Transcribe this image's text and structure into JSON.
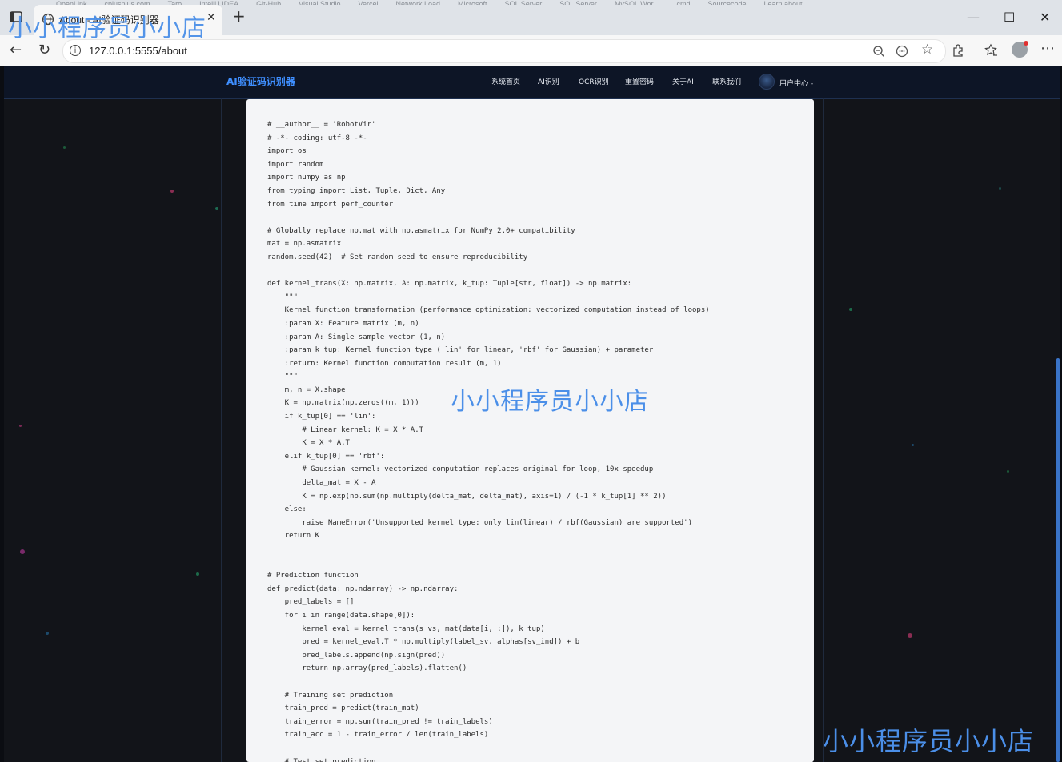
{
  "browser": {
    "bookmarks_partial": [
      "OpenLink",
      "cplusplus.com",
      "Taro",
      "IntelliJ IDEA",
      "Git-Hub",
      "Visual Studio",
      "Vercel",
      "Network Load",
      "Microsoft",
      "SQL Server",
      "SQL Server",
      "MySQL Wor...",
      "cmd",
      "Sourcecode",
      "Learn about"
    ],
    "tab_title": "About - AI验证码识别器",
    "url": "127.0.0.1:5555/about",
    "new_tab_symbol": "+",
    "close_symbol": "✕",
    "icons": [
      "window-icon",
      "globe-icon",
      "back-icon",
      "refresh-icon",
      "info-icon",
      "zoom-icon",
      "reader-icon",
      "favorite-icon",
      "extensions-icon",
      "collections-icon",
      "profile-icon",
      "more-icon",
      "minimize-icon",
      "maximize-icon",
      "close-icon"
    ]
  },
  "site": {
    "brand": "AI验证码识别器",
    "menu": [
      "系统首页",
      "AI识别",
      "OCR识别",
      "重置密码",
      "关于AI",
      "联系我们"
    ],
    "user_menu": "用户中心 -",
    "accent_color": "#3f8fff"
  },
  "code_lines": [
    "# __author__ = 'RobotVir'",
    "# -*- coding: utf-8 -*-",
    "import os",
    "import random",
    "import numpy as np",
    "from typing import List, Tuple, Dict, Any",
    "from time import perf_counter",
    "",
    "# Globally replace np.mat with np.asmatrix for NumPy 2.0+ compatibility",
    "mat = np.asmatrix",
    "random.seed(42)  # Set random seed to ensure reproducibility",
    "",
    "def kernel_trans(X: np.matrix, A: np.matrix, k_tup: Tuple[str, float]) -> np.matrix:",
    "    \"\"\"",
    "    Kernel function transformation (performance optimization: vectorized computation instead of loops)",
    "    :param X: Feature matrix (m, n)",
    "    :param A: Single sample vector (1, n)",
    "    :param k_tup: Kernel function type ('lin' for linear, 'rbf' for Gaussian) + parameter",
    "    :return: Kernel function computation result (m, 1)",
    "    \"\"\"",
    "    m, n = X.shape",
    "    K = np.matrix(np.zeros((m, 1)))",
    "    if k_tup[0] == 'lin':",
    "        # Linear kernel: K = X * A.T",
    "        K = X * A.T",
    "    elif k_tup[0] == 'rbf':",
    "        # Gaussian kernel: vectorized computation replaces original for loop, 10x speedup",
    "        delta_mat = X - A",
    "        K = np.exp(np.sum(np.multiply(delta_mat, delta_mat), axis=1) / (-1 * k_tup[1] ** 2))",
    "    else:",
    "        raise NameError('Unsupported kernel type: only lin(linear) / rbf(Gaussian) are supported')",
    "    return K",
    "",
    "",
    "# Prediction function",
    "def predict(data: np.ndarray) -> np.ndarray:",
    "    pred_labels = []",
    "    for i in range(data.shape[0]):",
    "        kernel_eval = kernel_trans(s_vs, mat(data[i, :]), k_tup)",
    "        pred = kernel_eval.T * np.multiply(label_sv, alphas[sv_ind]) + b",
    "        pred_labels.append(np.sign(pred))",
    "        return np.array(pred_labels).flatten()",
    "",
    "    # Training set prediction",
    "    train_pred = predict(train_mat)",
    "    train_error = np.sum(train_pred != train_labels)",
    "    train_acc = 1 - train_error / len(train_labels)",
    "",
    "    # Test set prediction"
  ],
  "watermark": "小小程序员小小店"
}
